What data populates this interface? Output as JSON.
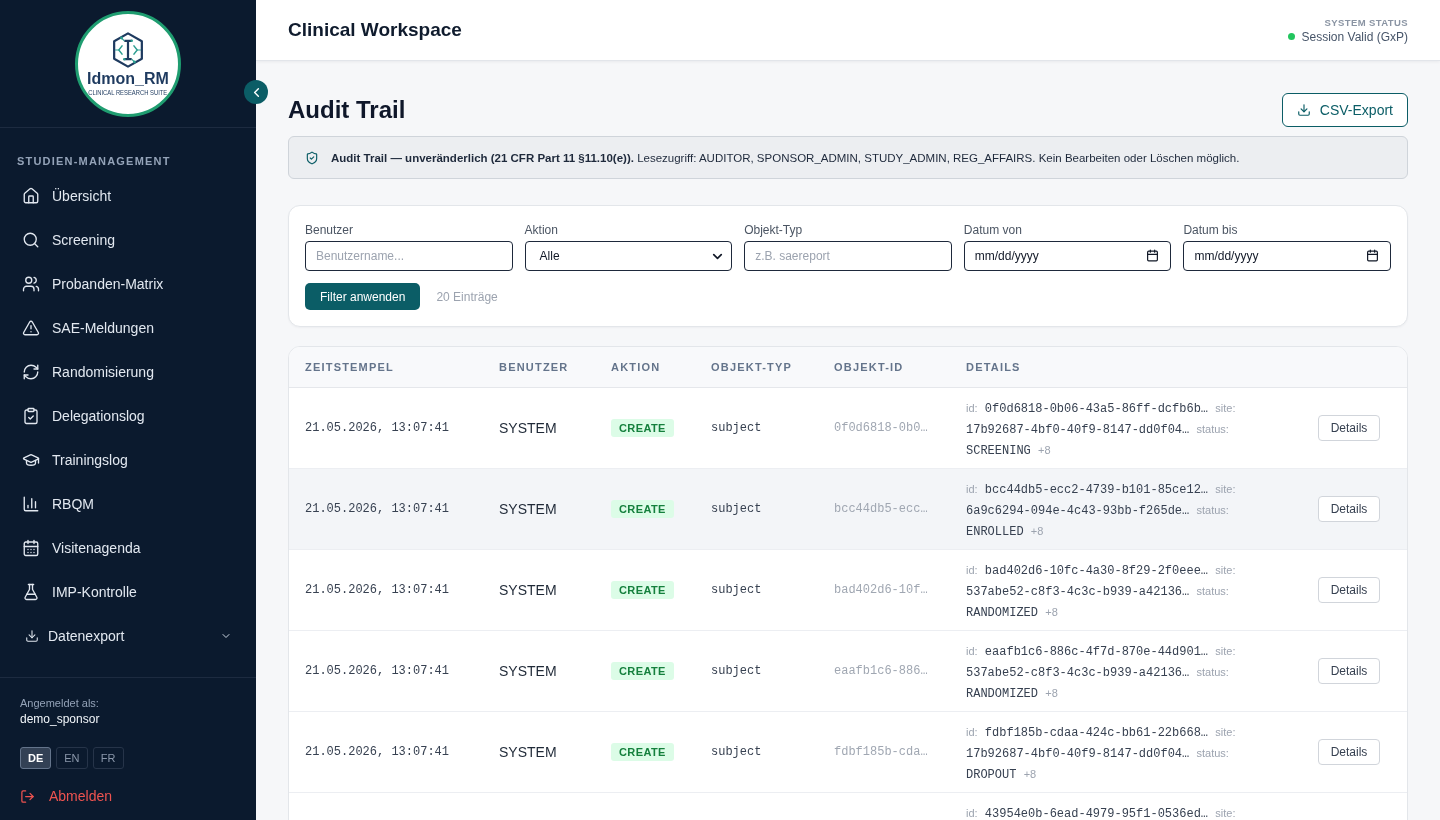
{
  "sidebar": {
    "logo": {
      "name": "Idmon_RM",
      "tagline": "CLINICAL RESEARCH SUITE"
    },
    "section_label": "STUDIEN-MANAGEMENT",
    "items": [
      {
        "label": "Übersicht",
        "kind": "link",
        "selected": false
      },
      {
        "label": "Screening",
        "kind": "link",
        "selected": false
      },
      {
        "label": "Probanden-Matrix",
        "kind": "link",
        "selected": false
      },
      {
        "label": "SAE-Meldungen",
        "kind": "link",
        "selected": false
      },
      {
        "label": "Randomisierung",
        "kind": "link",
        "selected": false
      },
      {
        "label": "Delegationslog",
        "kind": "link",
        "selected": false
      },
      {
        "label": "Trainingslog",
        "kind": "link",
        "selected": false
      },
      {
        "label": "RBQM",
        "kind": "link",
        "selected": false
      },
      {
        "label": "Visitenagenda",
        "kind": "link",
        "selected": false
      },
      {
        "label": "IMP-Kontrolle",
        "kind": "link",
        "selected": false
      },
      {
        "label": "Datenexport",
        "kind": "group",
        "selected": false,
        "expanded": false
      }
    ],
    "user_label": "Angemeldet als:",
    "username": "demo_sponsor",
    "languages": [
      {
        "label": "DE",
        "selected": true
      },
      {
        "label": "EN",
        "selected": false
      },
      {
        "label": "FR",
        "selected": false
      }
    ],
    "logout": "Abmelden"
  },
  "header": {
    "title": "Clinical Workspace",
    "status_label": "SYSTEM STATUS",
    "status": "Session Valid (GxP)"
  },
  "page": {
    "title": "Audit Trail",
    "export_button": "CSV-Export"
  },
  "notice": "**Audit Trail — unveränderlich (21 CFR Part 11 §11.10(e)).** Lesezugriff: AUDITOR, SPONSOR_ADMIN, STUDY_ADMIN, REG_AFFAIRS. Kein Bearbeiten oder Löschen möglich.",
  "filters": {
    "fields": [
      {
        "label": "Benutzer",
        "kind": "text",
        "placeholder": "Benutzername..."
      },
      {
        "label": "Aktion",
        "kind": "select",
        "value": "Alle"
      },
      {
        "label": "Objekt-Typ",
        "kind": "text",
        "placeholder": "z.B. saereport"
      },
      {
        "label": "Datum von",
        "kind": "date",
        "placeholder": "mm/dd/yyyy"
      },
      {
        "label": "Datum bis",
        "kind": "date",
        "placeholder": "mm/dd/yyyy"
      }
    ],
    "apply_button": "Filter anwenden",
    "count": "20 Einträge"
  },
  "table": {
    "columns": [
      "ZEITSTEMPEL",
      "BENUTZER",
      "AKTION",
      "OBJEKT-TYP",
      "OBJEKT-ID",
      "DETAILS"
    ],
    "rows": [
      {
        "hovered": false,
        "timestamp": "21.05.2026, 13:07:41",
        "user": "SYSTEM",
        "action": {
          "label": "CREATE",
          "kind": "create"
        },
        "object_type": "subject",
        "object_id": "0f0d6818-0b0…",
        "details": [
          {
            "kind": "key",
            "text": "id:"
          },
          {
            "kind": "data",
            "text": "0f0d6818-0b06-43a5-86ff-dcfb6b…"
          },
          {
            "kind": "key",
            "text": "site:"
          },
          {
            "kind": "data",
            "text": "17b92687-4bf0-40f9-8147-dd0f04…"
          },
          {
            "kind": "key",
            "text": "status:"
          },
          {
            "kind": "data",
            "text": "SCREENING"
          },
          {
            "kind": "more",
            "text": "+8"
          }
        ],
        "button": "Details"
      },
      {
        "hovered": true,
        "timestamp": "21.05.2026, 13:07:41",
        "user": "SYSTEM",
        "action": {
          "label": "CREATE",
          "kind": "create"
        },
        "object_type": "subject",
        "object_id": "bcc44db5-ecc…",
        "details": [
          {
            "kind": "key",
            "text": "id:"
          },
          {
            "kind": "data",
            "text": "bcc44db5-ecc2-4739-b101-85ce12…"
          },
          {
            "kind": "key",
            "text": "site:"
          },
          {
            "kind": "data",
            "text": "6a9c6294-094e-4c43-93bb-f265de…"
          },
          {
            "kind": "key",
            "text": "status:"
          },
          {
            "kind": "data",
            "text": "ENROLLED"
          },
          {
            "kind": "more",
            "text": "+8"
          }
        ],
        "button": "Details"
      },
      {
        "hovered": false,
        "timestamp": "21.05.2026, 13:07:41",
        "user": "SYSTEM",
        "action": {
          "label": "CREATE",
          "kind": "create"
        },
        "object_type": "subject",
        "object_id": "bad402d6-10f…",
        "details": [
          {
            "kind": "key",
            "text": "id:"
          },
          {
            "kind": "data",
            "text": "bad402d6-10fc-4a30-8f29-2f0eee…"
          },
          {
            "kind": "key",
            "text": "site:"
          },
          {
            "kind": "data",
            "text": "537abe52-c8f3-4c3c-b939-a42136…"
          },
          {
            "kind": "key",
            "text": "status:"
          },
          {
            "kind": "data",
            "text": "RANDOMIZED"
          },
          {
            "kind": "more",
            "text": "+8"
          }
        ],
        "button": "Details"
      },
      {
        "hovered": false,
        "timestamp": "21.05.2026, 13:07:41",
        "user": "SYSTEM",
        "action": {
          "label": "CREATE",
          "kind": "create"
        },
        "object_type": "subject",
        "object_id": "eaafb1c6-886…",
        "details": [
          {
            "kind": "key",
            "text": "id:"
          },
          {
            "kind": "data",
            "text": "eaafb1c6-886c-4f7d-870e-44d901…"
          },
          {
            "kind": "key",
            "text": "site:"
          },
          {
            "kind": "data",
            "text": "537abe52-c8f3-4c3c-b939-a42136…"
          },
          {
            "kind": "key",
            "text": "status:"
          },
          {
            "kind": "data",
            "text": "RANDOMIZED"
          },
          {
            "kind": "more",
            "text": "+8"
          }
        ],
        "button": "Details"
      },
      {
        "hovered": false,
        "timestamp": "21.05.2026, 13:07:41",
        "user": "SYSTEM",
        "action": {
          "label": "CREATE",
          "kind": "create"
        },
        "object_type": "subject",
        "object_id": "fdbf185b-cda…",
        "details": [
          {
            "kind": "key",
            "text": "id:"
          },
          {
            "kind": "data",
            "text": "fdbf185b-cdaa-424c-bb61-22b668…"
          },
          {
            "kind": "key",
            "text": "site:"
          },
          {
            "kind": "data",
            "text": "17b92687-4bf0-40f9-8147-dd0f04…"
          },
          {
            "kind": "key",
            "text": "status:"
          },
          {
            "kind": "data",
            "text": "DROPOUT"
          },
          {
            "kind": "more",
            "text": "+8"
          }
        ],
        "button": "Details"
      },
      {
        "hovered": false,
        "details": [
          {
            "kind": "key",
            "text": "id:"
          },
          {
            "kind": "data",
            "text": "43954e0b-6ead-4979-95f1-0536ed…"
          },
          {
            "kind": "key",
            "text": "site:"
          }
        ]
      }
    ]
  }
}
